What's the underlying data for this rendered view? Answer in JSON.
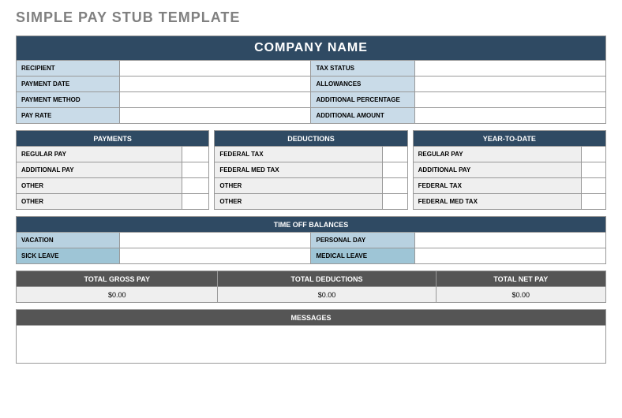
{
  "page_title": "SIMPLE PAY STUB TEMPLATE",
  "company_name": "COMPANY NAME",
  "info": {
    "left": [
      {
        "label": "RECIPIENT",
        "value": ""
      },
      {
        "label": "PAYMENT DATE",
        "value": ""
      },
      {
        "label": "PAYMENT METHOD",
        "value": ""
      },
      {
        "label": "PAY RATE",
        "value": ""
      }
    ],
    "right": [
      {
        "label": "TAX STATUS",
        "value": ""
      },
      {
        "label": "ALLOWANCES",
        "value": ""
      },
      {
        "label": "ADDITIONAL PERCENTAGE",
        "value": ""
      },
      {
        "label": "ADDITIONAL AMOUNT",
        "value": ""
      }
    ]
  },
  "sections": {
    "payments": {
      "header": "PAYMENTS",
      "rows": [
        {
          "label": "REGULAR PAY",
          "value": ""
        },
        {
          "label": "ADDITIONAL PAY",
          "value": ""
        },
        {
          "label": "OTHER",
          "value": ""
        },
        {
          "label": "OTHER",
          "value": ""
        }
      ]
    },
    "deductions": {
      "header": "DEDUCTIONS",
      "rows": [
        {
          "label": "FEDERAL TAX",
          "value": ""
        },
        {
          "label": "FEDERAL MED TAX",
          "value": ""
        },
        {
          "label": "OTHER",
          "value": ""
        },
        {
          "label": "OTHER",
          "value": ""
        }
      ]
    },
    "ytd": {
      "header": "YEAR-TO-DATE",
      "rows": [
        {
          "label": "REGULAR PAY",
          "value": ""
        },
        {
          "label": "ADDITIONAL PAY",
          "value": ""
        },
        {
          "label": "FEDERAL TAX",
          "value": ""
        },
        {
          "label": "FEDERAL MED TAX",
          "value": ""
        }
      ]
    }
  },
  "timeoff": {
    "header": "TIME OFF BALANCES",
    "left": [
      {
        "label": "VACATION",
        "value": ""
      },
      {
        "label": "SICK LEAVE",
        "value": ""
      }
    ],
    "right": [
      {
        "label": "PERSONAL DAY",
        "value": ""
      },
      {
        "label": "MEDICAL LEAVE",
        "value": ""
      }
    ]
  },
  "totals": {
    "gross": {
      "header": "TOTAL GROSS PAY",
      "value": "$0.00"
    },
    "deductions": {
      "header": "TOTAL DEDUCTIONS",
      "value": "$0.00"
    },
    "net": {
      "header": "TOTAL NET PAY",
      "value": "$0.00"
    }
  },
  "messages": {
    "header": "MESSAGES",
    "body": ""
  }
}
